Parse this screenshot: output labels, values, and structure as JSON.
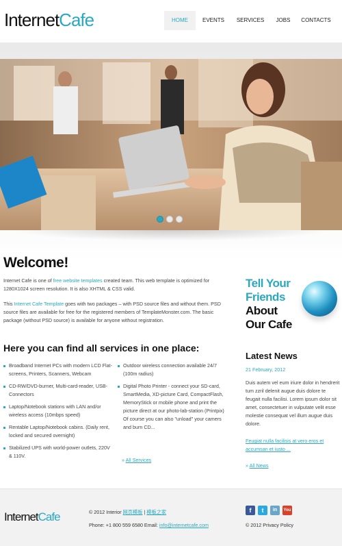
{
  "header": {
    "logo_part1": "Internet",
    "logo_part2": "Cafe",
    "nav": [
      "HOME",
      "EVENTS",
      "SERVICES",
      "JOBS",
      "CONTACTS"
    ]
  },
  "welcome": {
    "title": "Welcome!",
    "p1_pre": "Internet Cafe is one of ",
    "p1_link": "free website templates",
    "p1_post": " created team. This web template is optimized for 1280X1024 screen resolution. It is also XHTML & CSS valid.",
    "p2_pre": "This ",
    "p2_link": "Internet Cafe Template",
    "p2_post": " goes with two packages – with PSD source files and without them. PSD source files are available for free for the registered members of TemplateMonster.com. The basic package (without PSD source) is available for anyone without registration."
  },
  "services": {
    "title": "Here you can find all services in one place:",
    "left": [
      "Broadband Internet PCs with modern LCD Flat-screens, Printers, Scanners, Webcam",
      "CD-RW/DVD-burner, Multi-card-reader, USB-Connectors",
      "Laptop/Notebook stations with LAN and/or wireless access (10mbps speed)",
      "Rentable Laptop/Notebook cabins. (Daily rent, locked and secured overnight)",
      "Stabilized UPS with world-power outlets, 220V & 110V."
    ],
    "right": [
      "Outdoor wireless connection available 24/7 (100m radius)",
      "Digital Photo Printer - connect your SD-card, SmartMedia, XD-picture Card, CompactFlash, MemoryStick or mobile phone and print the picture direct at our photo-lab-station (Printpix) Of course you can also \"unload\" your camers and burn CD..."
    ],
    "all_link": "All Services"
  },
  "tell": {
    "line1": "Tell Your",
    "line2": "Friends",
    "line3": "About",
    "line4": "Our Cafe"
  },
  "news": {
    "title": "Latest News",
    "date": "21 February, 2012",
    "text": "Duis autem vel eum iriure dolor in hendrerit tum zzril delenit augue duis dolore te feugait nulla facilisi. Lorem ipsum dolor sit amet, consectetuer in vulputate velit esse molestie consequat vel illum augue duis dolore.",
    "link": "Feugiat nulla facilisis at vero eros et accumsan et iusto ...",
    "all_link": "All News"
  },
  "footer": {
    "logo_part1": "Internet",
    "logo_part2": "Cafe",
    "copyright_pre": "© 2012 Interior ",
    "copyright_link1": "网页模板",
    "copyright_sep": " | ",
    "copyright_link2": "模板之家",
    "contact_pre": "Phone: +1 800 559 6580 Email: ",
    "email": "info@internetcafe.com",
    "privacy": "© 2012 Privacy Policy",
    "social": [
      "f",
      "t",
      "in",
      "You"
    ]
  },
  "slider": {
    "slides": 3,
    "active_index": 0
  },
  "colors": {
    "accent": "#2aa8c0",
    "text": "#111111"
  }
}
